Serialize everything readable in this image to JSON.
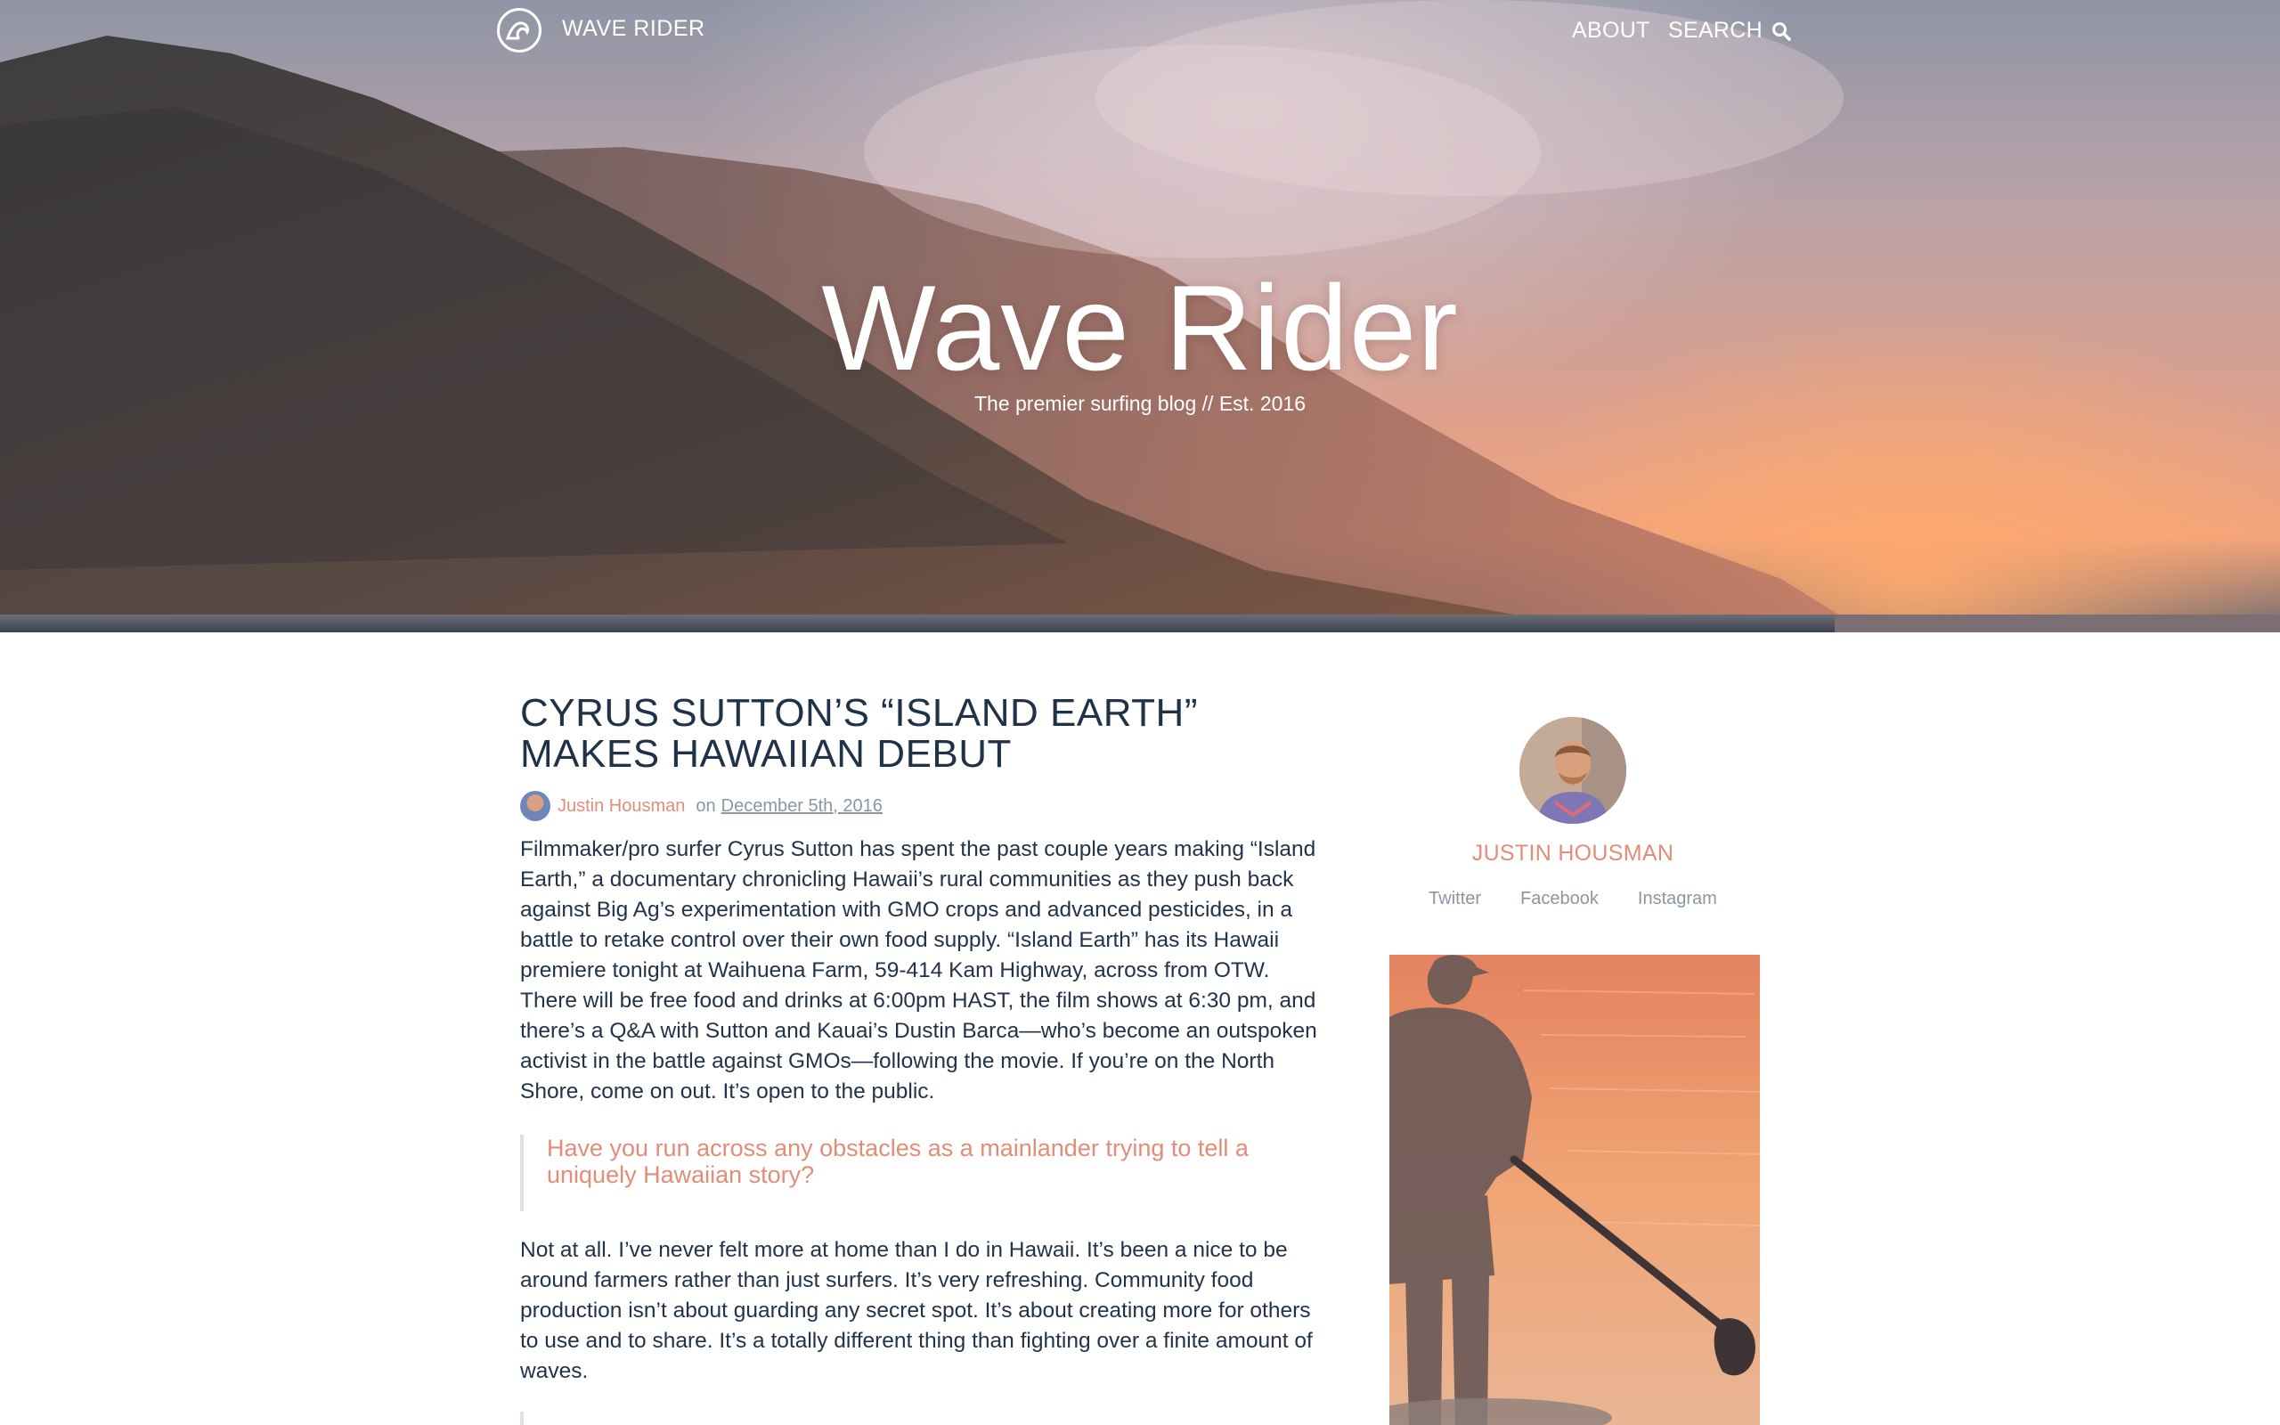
{
  "header": {
    "brand": "WAVE RIDER",
    "nav": {
      "about": "ABOUT",
      "search": "SEARCH"
    }
  },
  "hero": {
    "title": "Wave Rider",
    "tagline": "The premier surfing blog // Est. 2016"
  },
  "post": {
    "title": "CYRUS SUTTON’S “ISLAND EARTH” MAKES HAWAIIAN DEBUT",
    "author": "Justin Housman",
    "on": "on",
    "date": "December 5th, 2016",
    "paragraph1": "Filmmaker/pro surfer Cyrus Sutton has spent the past couple years making “Island Earth,” a documentary chronicling Hawaii’s rural communities as they push back against Big Ag’s experimentation with GMO crops and advanced pesticides, in a battle to retake control over their own food supply. “Island Earth” has its Hawaii premiere tonight at Waihuena Farm, 59-414 Kam Highway, across from OTW. There will be free food and drinks at 6:00pm HAST, the film shows at 6:30 pm, and there’s a Q&A with Sutton and Kauai’s Dustin Barca—who’s become an outspoken activist in the battle against GMOs—following the movie. If you’re on the North Shore, come on out. It’s open to the public.",
    "quote": "Have you run across any obstacles as a mainlander trying to tell a uniquely Hawaiian story?",
    "paragraph2": "Not at all. I’ve never felt more at home than I do in Hawaii. It’s been a nice to be around farmers rather than just surfers. It’s very refreshing. Community food production isn’t about guarding any secret spot. It’s about creating more for others to use and to share. It’s a totally different thing than fighting over a finite amount of waves."
  },
  "sidebar": {
    "author_name": "JUSTIN HOUSMAN",
    "social": [
      "Twitter",
      "Facebook",
      "Instagram"
    ]
  },
  "colors": {
    "accent": "#e28d78",
    "heading": "#1f3247",
    "muted": "#8b96a3"
  },
  "icons": {
    "logo": "wave-logo-icon",
    "search": "search-icon"
  }
}
